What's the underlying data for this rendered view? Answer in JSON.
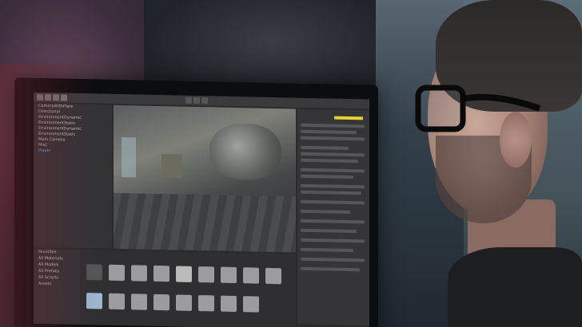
{
  "photo": {
    "subject": "developer-at-monitor",
    "screen_app": {
      "toolbar_icons": [
        "hand-icon",
        "move-icon",
        "rotate-icon",
        "scale-icon"
      ],
      "play_controls": [
        "play-icon",
        "pause-icon",
        "step-icon"
      ],
      "hierarchy_items": [
        "CameraWithFlare",
        "Directional",
        "EnvironmentDynamic",
        "EnvironmentStatic",
        "EnvironmentDynamic",
        "EnvironmentStatic",
        "Main Camera",
        "Misc",
        "Player"
      ],
      "project_tree_items": [
        "Favorites",
        "All Materials",
        "All Models",
        "All Prefabs",
        "All Scripts",
        "Assets"
      ]
    }
  }
}
